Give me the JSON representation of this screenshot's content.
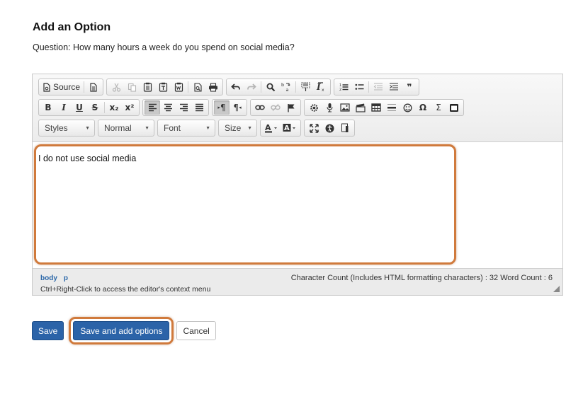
{
  "page": {
    "heading": "Add an Option",
    "question": "Question: How many hours a week do you spend on social media?"
  },
  "editor": {
    "toolbar": {
      "source_label": "Source",
      "styles": "Styles",
      "format": "Normal",
      "font": "Font",
      "size": "Size",
      "bold": "B",
      "italic": "I",
      "underline": "U",
      "strike": "S",
      "subscript": "x₂",
      "superscript": "x²",
      "ltr": "¶",
      "rtl": "¶",
      "omega": "Ω",
      "sigma": "Σ",
      "blockquote": "❞"
    },
    "content": "I do not use social media",
    "path": [
      "body",
      "p"
    ],
    "count_text": "Character Count (Includes HTML formatting characters) : 32 Word Count : 6",
    "context_hint": "Ctrl+Right-Click to access the editor's context menu"
  },
  "actions": {
    "save": "Save",
    "save_add": "Save and add options",
    "cancel": "Cancel"
  },
  "colors": {
    "primary_button": "#2b63a8",
    "highlight": "#d07a3c",
    "path_link": "#2966a8"
  }
}
